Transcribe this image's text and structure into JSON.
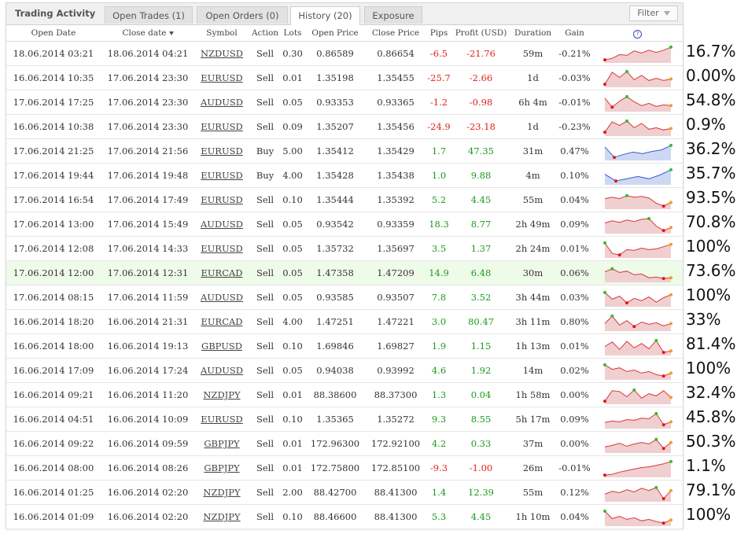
{
  "panel": {
    "title": "Trading Activity",
    "tabs": [
      {
        "label": "Open Trades (1)"
      },
      {
        "label": "Open Orders (0)"
      },
      {
        "label": "History (20)"
      },
      {
        "label": "Exposure"
      }
    ],
    "filter_label": "Filter"
  },
  "table": {
    "headers": [
      "Open Date",
      "Close date",
      "Symbol",
      "Action",
      "Lots",
      "Open Price",
      "Close Price",
      "Pips",
      "Profit (USD)",
      "Duration",
      "Gain"
    ],
    "help_label": "?",
    "rows": [
      {
        "open": "18.06.2014 03:21",
        "close": "18.06.2014 04:21",
        "symbol": "NZDUSD",
        "action": "Sell",
        "lots": "0.30",
        "open_price": "0.86589",
        "close_price": "0.86654",
        "pips": "-6.5",
        "profit": "-21.76",
        "duration": "59m",
        "gain": "-0.21%",
        "spark": [
          0.1,
          0.2,
          0.45,
          0.4,
          0.7,
          0.55,
          0.75,
          0.6,
          0.75,
          0.95
        ],
        "dir": "sell",
        "pct": "16.7%"
      },
      {
        "open": "16.06.2014 10:35",
        "close": "17.06.2014 23:30",
        "symbol": "EURUSD",
        "action": "Sell",
        "lots": "0.01",
        "open_price": "1.35198",
        "close_price": "1.35455",
        "pips": "-25.7",
        "profit": "-2.66",
        "duration": "1d",
        "gain": "-0.03%",
        "spark": [
          0.1,
          0.9,
          0.55,
          0.95,
          0.4,
          0.7,
          0.35,
          0.5,
          0.35,
          0.45
        ],
        "dir": "sell",
        "pct": "0.00%"
      },
      {
        "open": "17.06.2014 17:25",
        "close": "17.06.2014 23:30",
        "symbol": "AUDUSD",
        "action": "Sell",
        "lots": "0.05",
        "open_price": "0.93353",
        "close_price": "0.93365",
        "pips": "-1.2",
        "profit": "-0.98",
        "duration": "6h 4m",
        "gain": "-0.01%",
        "spark": [
          0.8,
          0.2,
          0.6,
          0.9,
          0.55,
          0.3,
          0.45,
          0.25,
          0.35,
          0.3
        ],
        "dir": "sell",
        "pct": "54.8%"
      },
      {
        "open": "16.06.2014 10:38",
        "close": "17.06.2014 23:30",
        "symbol": "EURUSD",
        "action": "Sell",
        "lots": "0.09",
        "open_price": "1.35207",
        "close_price": "1.35456",
        "pips": "-24.9",
        "profit": "-23.18",
        "duration": "1d",
        "gain": "-0.23%",
        "spark": [
          0.15,
          0.85,
          0.6,
          0.9,
          0.45,
          0.75,
          0.35,
          0.45,
          0.3,
          0.4
        ],
        "dir": "sell",
        "pct": "0.9%"
      },
      {
        "open": "17.06.2014 21:25",
        "close": "17.06.2014 21:56",
        "symbol": "EURUSD",
        "action": "Buy",
        "lots": "5.00",
        "open_price": "1.35412",
        "close_price": "1.35429",
        "pips": "1.7",
        "profit": "47.35",
        "duration": "31m",
        "gain": "0.47%",
        "spark": [
          0.8,
          0.1,
          0.3,
          0.45,
          0.35,
          0.5,
          0.6,
          0.9
        ],
        "dir": "buy",
        "pct": "36.2%"
      },
      {
        "open": "17.06.2014 19:44",
        "close": "17.06.2014 19:48",
        "symbol": "EURUSD",
        "action": "Buy",
        "lots": "4.00",
        "open_price": "1.35428",
        "close_price": "1.35438",
        "pips": "1.0",
        "profit": "9.88",
        "duration": "4m",
        "gain": "0.10%",
        "spark": [
          0.6,
          0.15,
          0.3,
          0.45,
          0.3,
          0.55,
          0.9
        ],
        "dir": "buy",
        "pct": "35.7%"
      },
      {
        "open": "17.06.2014 16:54",
        "close": "17.06.2014 17:49",
        "symbol": "EURUSD",
        "action": "Sell",
        "lots": "0.10",
        "open_price": "1.35444",
        "close_price": "1.35392",
        "pips": "5.2",
        "profit": "4.45",
        "duration": "55m",
        "gain": "0.04%",
        "spark": [
          0.6,
          0.7,
          0.6,
          0.8,
          0.7,
          0.75,
          0.65,
          0.3,
          0.1,
          0.35
        ],
        "dir": "sell",
        "pct": "93.5%"
      },
      {
        "open": "17.06.2014 13:00",
        "close": "17.06.2014 15:49",
        "symbol": "AUDUSD",
        "action": "Sell",
        "lots": "0.05",
        "open_price": "0.93542",
        "close_price": "0.93359",
        "pips": "18.3",
        "profit": "8.77",
        "duration": "2h 49m",
        "gain": "0.09%",
        "spark": [
          0.6,
          0.75,
          0.65,
          0.8,
          0.7,
          0.85,
          0.9,
          0.4,
          0.1,
          0.3
        ],
        "dir": "sell",
        "pct": "70.8%"
      },
      {
        "open": "17.06.2014 12:08",
        "close": "17.06.2014 14:33",
        "symbol": "EURUSD",
        "action": "Sell",
        "lots": "0.05",
        "open_price": "1.35732",
        "close_price": "1.35697",
        "pips": "3.5",
        "profit": "1.37",
        "duration": "2h 24m",
        "gain": "0.01%",
        "spark": [
          0.9,
          0.2,
          0.1,
          0.45,
          0.4,
          0.55,
          0.45,
          0.5,
          0.65,
          0.8
        ],
        "dir": "sell",
        "pct": "100%"
      },
      {
        "open": "17.06.2014 12:00",
        "close": "17.06.2014 12:31",
        "symbol": "EURCAD",
        "action": "Sell",
        "lots": "0.05",
        "open_price": "1.47358",
        "close_price": "1.47209",
        "pips": "14.9",
        "profit": "6.48",
        "duration": "30m",
        "gain": "0.06%",
        "spark": [
          0.6,
          0.8,
          0.55,
          0.65,
          0.4,
          0.45,
          0.2,
          0.25,
          0.15,
          0.2
        ],
        "dir": "sell",
        "hl": true,
        "pct": "73.6%"
      },
      {
        "open": "17.06.2014 08:15",
        "close": "17.06.2014 11:59",
        "symbol": "AUDUSD",
        "action": "Sell",
        "lots": "0.05",
        "open_price": "0.93585",
        "close_price": "0.93507",
        "pips": "7.8",
        "profit": "3.52",
        "duration": "3h 44m",
        "gain": "0.03%",
        "spark": [
          0.85,
          0.4,
          0.6,
          0.15,
          0.45,
          0.3,
          0.55,
          0.2,
          0.5,
          0.7
        ],
        "dir": "sell",
        "pct": "100%"
      },
      {
        "open": "16.06.2014 18:20",
        "close": "16.06.2014 21:31",
        "symbol": "EURCAD",
        "action": "Sell",
        "lots": "4.00",
        "open_price": "1.47251",
        "close_price": "1.47221",
        "pips": "3.0",
        "profit": "80.47",
        "duration": "3h 11m",
        "gain": "0.80%",
        "spark": [
          0.4,
          0.9,
          0.3,
          0.6,
          0.2,
          0.5,
          0.35,
          0.45,
          0.25,
          0.4
        ],
        "dir": "sell",
        "pct": "33%"
      },
      {
        "open": "16.06.2014 18:00",
        "close": "16.06.2014 19:13",
        "symbol": "GBPUSD",
        "action": "Sell",
        "lots": "0.10",
        "open_price": "1.69846",
        "close_price": "1.69827",
        "pips": "1.9",
        "profit": "1.15",
        "duration": "1h 13m",
        "gain": "0.01%",
        "spark": [
          0.5,
          0.8,
          0.3,
          0.85,
          0.4,
          0.7,
          0.35,
          0.9,
          0.1,
          0.2
        ],
        "dir": "sell",
        "pct": "81.4%"
      },
      {
        "open": "16.06.2014 17:09",
        "close": "16.06.2014 17:24",
        "symbol": "AUDUSD",
        "action": "Sell",
        "lots": "0.05",
        "open_price": "0.94038",
        "close_price": "0.93992",
        "pips": "4.6",
        "profit": "1.92",
        "duration": "14m",
        "gain": "0.02%",
        "spark": [
          0.9,
          0.6,
          0.7,
          0.45,
          0.55,
          0.35,
          0.45,
          0.25,
          0.15,
          0.35
        ],
        "dir": "sell",
        "pct": "100%"
      },
      {
        "open": "16.06.2014 09:21",
        "close": "16.06.2014 11:20",
        "symbol": "NZDJPY",
        "action": "Sell",
        "lots": "0.01",
        "open_price": "88.38600",
        "close_price": "88.37300",
        "pips": "1.3",
        "profit": "0.04",
        "duration": "1h 58m",
        "gain": "0.00%",
        "spark": [
          0.1,
          0.8,
          0.75,
          0.4,
          0.85,
          0.3,
          0.6,
          0.45,
          0.8,
          0.35
        ],
        "dir": "sell",
        "pct": "32.4%"
      },
      {
        "open": "16.06.2014 04:51",
        "close": "16.06.2014 10:09",
        "symbol": "EURUSD",
        "action": "Sell",
        "lots": "0.10",
        "open_price": "1.35365",
        "close_price": "1.35272",
        "pips": "9.3",
        "profit": "8.55",
        "duration": "5h 17m",
        "gain": "0.09%",
        "spark": [
          0.3,
          0.4,
          0.35,
          0.5,
          0.45,
          0.6,
          0.55,
          0.9,
          0.15,
          0.35
        ],
        "dir": "sell",
        "pct": "45.8%"
      },
      {
        "open": "16.06.2014 09:22",
        "close": "16.06.2014 09:59",
        "symbol": "GBPJPY",
        "action": "Sell",
        "lots": "0.01",
        "open_price": "172.96300",
        "close_price": "172.92100",
        "pips": "4.2",
        "profit": "0.33",
        "duration": "37m",
        "gain": "0.00%",
        "spark": [
          0.3,
          0.4,
          0.55,
          0.35,
          0.5,
          0.6,
          0.5,
          0.8,
          0.2,
          0.6
        ],
        "dir": "sell",
        "pct": "50.3%"
      },
      {
        "open": "16.06.2014 08:00",
        "close": "16.06.2014 08:26",
        "symbol": "GBPJPY",
        "action": "Sell",
        "lots": "0.01",
        "open_price": "172.75800",
        "close_price": "172.85100",
        "pips": "-9.3",
        "profit": "-1.00",
        "duration": "26m",
        "gain": "-0.01%",
        "spark": [
          0.05,
          0.1,
          0.25,
          0.35,
          0.45,
          0.55,
          0.6,
          0.7,
          0.8,
          0.95
        ],
        "dir": "sell",
        "pct": "1.1%"
      },
      {
        "open": "16.06.2014 01:25",
        "close": "16.06.2014 02:20",
        "symbol": "NZDJPY",
        "action": "Sell",
        "lots": "2.00",
        "open_price": "88.42700",
        "close_price": "88.41300",
        "pips": "1.4",
        "profit": "12.39",
        "duration": "55m",
        "gain": "0.12%",
        "spark": [
          0.4,
          0.6,
          0.5,
          0.7,
          0.55,
          0.8,
          0.65,
          0.85,
          0.1,
          0.65
        ],
        "dir": "sell",
        "pct": "79.1%"
      },
      {
        "open": "16.06.2014 01:09",
        "close": "16.06.2014 02:20",
        "symbol": "NZDJPY",
        "action": "Sell",
        "lots": "0.10",
        "open_price": "88.46600",
        "close_price": "88.41300",
        "pips": "5.3",
        "profit": "4.45",
        "duration": "1h 10m",
        "gain": "0.04%",
        "spark": [
          0.9,
          0.4,
          0.55,
          0.35,
          0.45,
          0.25,
          0.35,
          0.2,
          0.1,
          0.3
        ],
        "dir": "sell",
        "pct": "100%"
      }
    ]
  },
  "colors": {
    "neg": "#e0201b",
    "pos": "#1a9a1a",
    "sell_line": "#d9383a",
    "sell_fill": "#f0cfd0",
    "buy_line": "#3f5bd6",
    "buy_fill": "#cdd8f2",
    "max_dot": "#2fbf2f",
    "min_dot": "#e01818",
    "end_dot": "#f0a020"
  }
}
